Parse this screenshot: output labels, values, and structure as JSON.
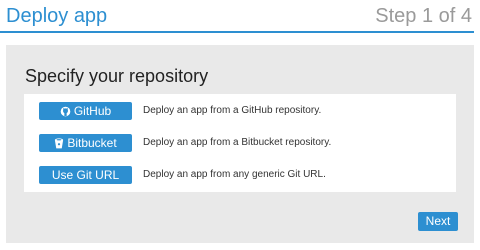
{
  "header": {
    "title": "Deploy app",
    "step": "Step 1 of 4"
  },
  "panel": {
    "title": "Specify your repository",
    "options": [
      {
        "label": "GitHub",
        "icon": "github-icon",
        "description": "Deploy an app from a GitHub repository."
      },
      {
        "label": "Bitbucket",
        "icon": "bitbucket-icon",
        "description": "Deploy an app from a Bitbucket repository."
      },
      {
        "label": "Use Git URL",
        "description": "Deploy an app from any generic Git URL."
      }
    ],
    "next_label": "Next"
  },
  "colors": {
    "accent": "#2d8fd1",
    "panel_bg": "#e9e9e9",
    "muted_text": "#9a9a9a"
  }
}
